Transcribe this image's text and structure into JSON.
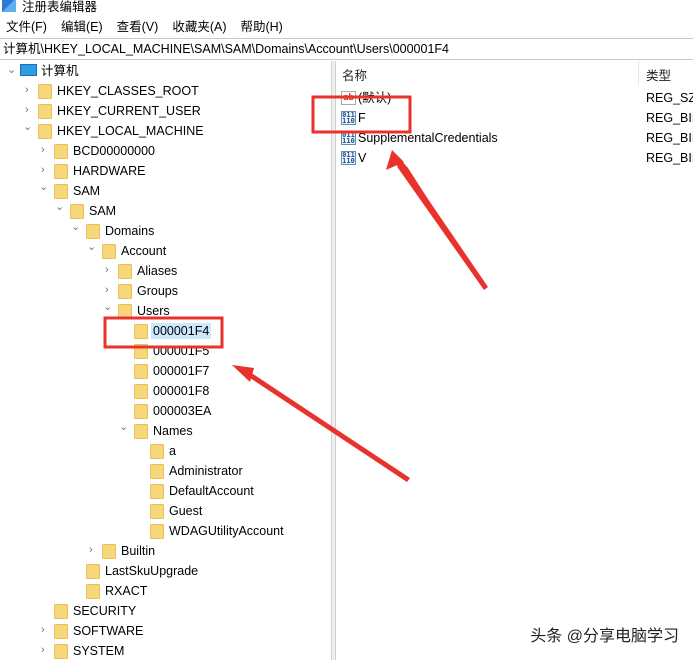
{
  "window": {
    "title": "注册表编辑器"
  },
  "menu": [
    "文件(F)",
    "编辑(E)",
    "查看(V)",
    "收藏夹(A)",
    "帮助(H)"
  ],
  "address": "计算机\\HKEY_LOCAL_MACHINE\\SAM\\SAM\\Domains\\Account\\Users\\000001F4",
  "tree": [
    {
      "label": "计算机",
      "level": 0,
      "state": "expanded",
      "icon": "computer-icon"
    },
    {
      "label": "HKEY_CLASSES_ROOT",
      "level": 1,
      "state": "collapsed"
    },
    {
      "label": "HKEY_CURRENT_USER",
      "level": 1,
      "state": "collapsed"
    },
    {
      "label": "HKEY_LOCAL_MACHINE",
      "level": 1,
      "state": "expanded"
    },
    {
      "label": "BCD00000000",
      "level": 2,
      "state": "collapsed"
    },
    {
      "label": "HARDWARE",
      "level": 2,
      "state": "collapsed"
    },
    {
      "label": "SAM",
      "level": 2,
      "state": "expanded"
    },
    {
      "label": "SAM",
      "level": 3,
      "state": "expanded"
    },
    {
      "label": "Domains",
      "level": 4,
      "state": "expanded"
    },
    {
      "label": "Account",
      "level": 5,
      "state": "expanded"
    },
    {
      "label": "Aliases",
      "level": 6,
      "state": "collapsed"
    },
    {
      "label": "Groups",
      "level": 6,
      "state": "collapsed"
    },
    {
      "label": "Users",
      "level": 6,
      "state": "expanded"
    },
    {
      "label": "000001F4",
      "level": 7,
      "state": "none",
      "selected": true
    },
    {
      "label": "000001F5",
      "level": 7,
      "state": "none"
    },
    {
      "label": "000001F7",
      "level": 7,
      "state": "none"
    },
    {
      "label": "000001F8",
      "level": 7,
      "state": "none"
    },
    {
      "label": "000003EA",
      "level": 7,
      "state": "none"
    },
    {
      "label": "Names",
      "level": 7,
      "state": "expanded"
    },
    {
      "label": "a",
      "level": 8,
      "state": "none"
    },
    {
      "label": "Administrator",
      "level": 8,
      "state": "none"
    },
    {
      "label": "DefaultAccount",
      "level": 8,
      "state": "none"
    },
    {
      "label": "Guest",
      "level": 8,
      "state": "none"
    },
    {
      "label": "WDAGUtilityAccount",
      "level": 8,
      "state": "none"
    },
    {
      "label": "Builtin",
      "level": 5,
      "state": "collapsed"
    },
    {
      "label": "LastSkuUpgrade",
      "level": 4,
      "state": "none"
    },
    {
      "label": "RXACT",
      "level": 4,
      "state": "none"
    },
    {
      "label": "SECURITY",
      "level": 2,
      "state": "none"
    },
    {
      "label": "SOFTWARE",
      "level": 2,
      "state": "collapsed"
    },
    {
      "label": "SYSTEM",
      "level": 2,
      "state": "collapsed"
    }
  ],
  "values": {
    "columns": {
      "name": "名称",
      "type": "类型"
    },
    "rows": [
      {
        "name": "(默认)",
        "type": "REG_SZ",
        "icon": "string-value-icon"
      },
      {
        "name": "F",
        "type": "REG_BINARY",
        "icon": "binary-value-icon"
      },
      {
        "name": "SupplementalCredentials",
        "type": "REG_BINARY",
        "icon": "binary-value-icon"
      },
      {
        "name": "V",
        "type": "REG_BINARY",
        "icon": "binary-value-icon"
      }
    ]
  },
  "annotation_color": "#e8322b",
  "watermark": "头条 @分享电脑学习"
}
